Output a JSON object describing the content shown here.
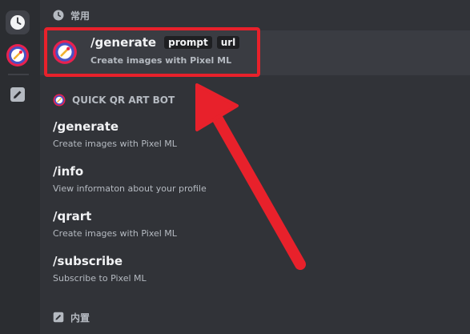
{
  "rail": {
    "items": [
      {
        "icon": "clock-icon"
      },
      {
        "icon": "bot-avatar-icon"
      },
      {
        "icon": "pencil-icon"
      }
    ]
  },
  "sections": {
    "recent": {
      "title": "常用",
      "icon": "clock-icon"
    },
    "bot": {
      "title": "QUICK QR ART BOT",
      "icon": "bot-avatar-icon"
    },
    "builtin": {
      "title": "内置",
      "icon": "pencil-icon"
    }
  },
  "selected": {
    "command": "/generate",
    "params": [
      "prompt",
      "url"
    ],
    "description": "Create images with Pixel ML"
  },
  "commands": [
    {
      "name": "/generate",
      "description": "Create images with Pixel ML"
    },
    {
      "name": "/info",
      "description": "View informaton about your profile"
    },
    {
      "name": "/qrart",
      "description": "Create images with Pixel ML"
    },
    {
      "name": "/subscribe",
      "description": "Subscribe to Pixel ML"
    }
  ],
  "colors": {
    "background": "#313338",
    "rail": "#2b2d31",
    "highlight": "#e8212b",
    "selected_row": "#3a3c42"
  }
}
